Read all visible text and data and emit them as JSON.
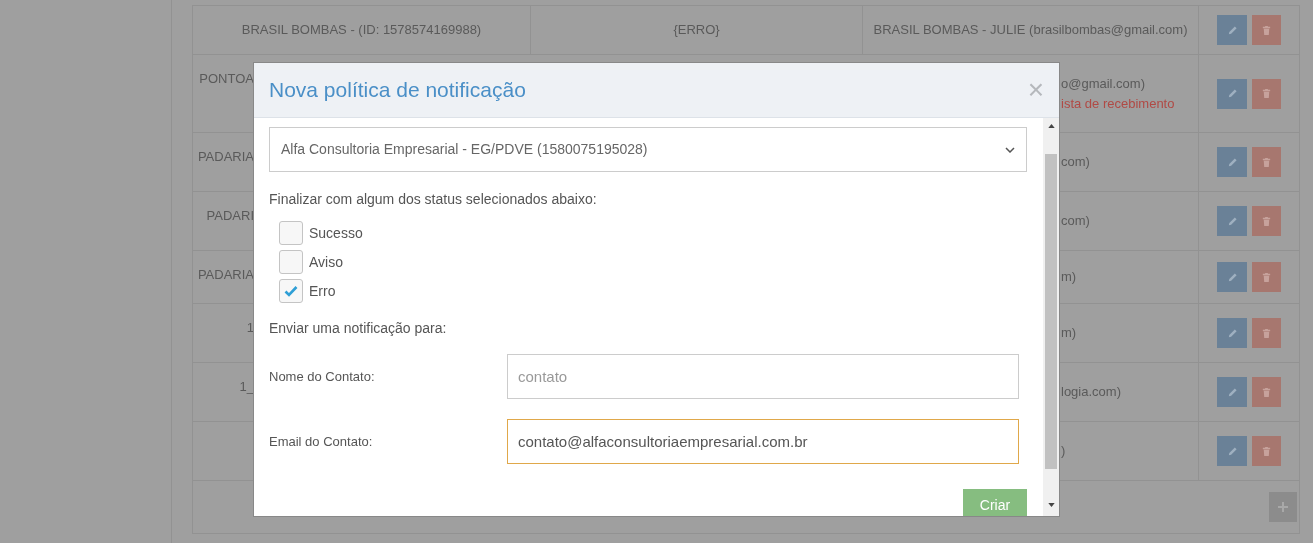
{
  "table": {
    "rows": [
      {
        "column_1": "BRASIL BOMBAS - (ID: 1578574169988)",
        "column_2": "{ERRO}",
        "column_3": "BRASIL BOMBAS - JULIE (brasilbombas@gmail.com)"
      },
      {
        "column_1": "PONTOA",
        "column_3": "o@gmail.com)",
        "warning": "ista de recebimento"
      },
      {
        "column_1": "PADARIA",
        "column_3": "com)"
      },
      {
        "column_1": "PADARI",
        "column_3": "com)"
      },
      {
        "column_1": "PADARIA",
        "column_3": "m)"
      },
      {
        "column_1": "1",
        "column_3": "m)"
      },
      {
        "column_1": "1_",
        "column_3": "logia.com)"
      },
      {
        "column_3": ")"
      }
    ]
  },
  "modal": {
    "title": "Nova política de notificação",
    "close": "×",
    "select": {
      "value": "Alfa Consultoria Empresarial - EG/PDVE (1580075195028)"
    },
    "status_label": "Finalizar com algum dos status selecionados abaixo:",
    "statuses": [
      {
        "label": "Sucesso",
        "checked": false
      },
      {
        "label": "Aviso",
        "checked": false
      },
      {
        "label": "Erro",
        "checked": true
      }
    ],
    "send_label": "Enviar uma notificação para:",
    "fields": [
      {
        "label": "Nome do Contato:",
        "placeholder": "contato",
        "focused": false
      },
      {
        "label": "Email do Contato:",
        "value": "contato@alfaconsultoriaempresarial.com.br",
        "focused": true
      }
    ],
    "submit": "Criar"
  }
}
